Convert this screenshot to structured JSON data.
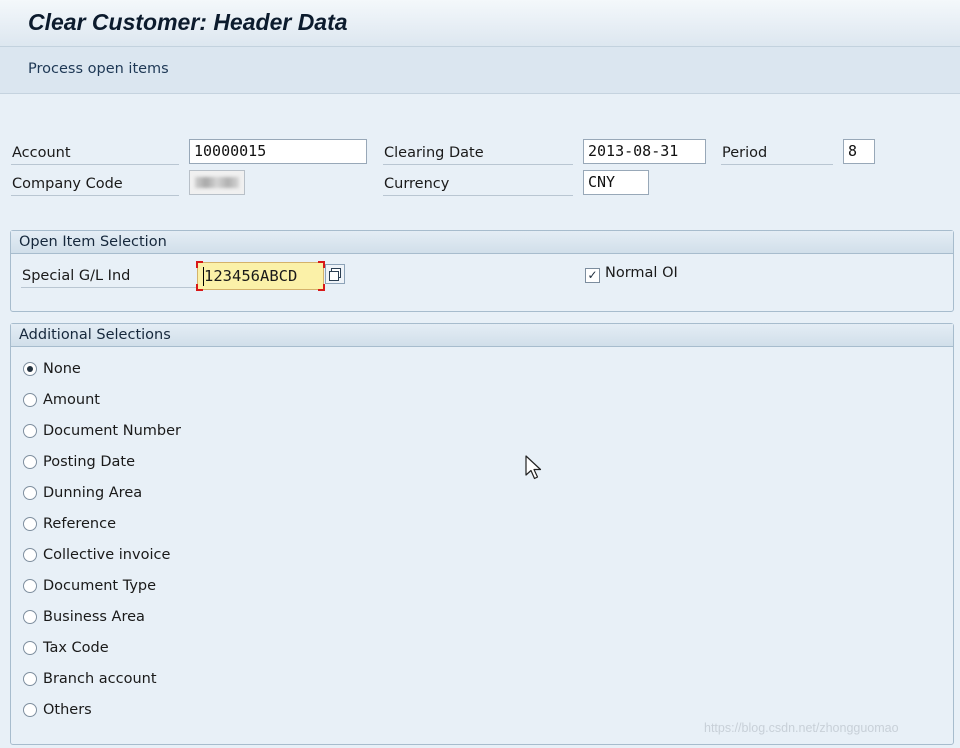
{
  "window": {
    "title": "Clear Customer: Header Data"
  },
  "toolbar": {
    "process_open_items": "Process open items"
  },
  "header": {
    "account": {
      "label": "Account",
      "value": "10000015"
    },
    "clearing_date": {
      "label": "Clearing Date",
      "value": "2013-08-31"
    },
    "period": {
      "label": "Period",
      "value": "8"
    },
    "company_code": {
      "label": "Company Code"
    },
    "currency": {
      "label": "Currency",
      "value": "CNY"
    }
  },
  "open_item_selection": {
    "title": "Open Item Selection",
    "special_gl_ind": {
      "label": "Special G/L Ind",
      "value": "123456ABCD"
    },
    "normal_oi": {
      "label": "Normal OI",
      "checked": true,
      "mark": "✓"
    }
  },
  "additional_selections": {
    "title": "Additional Selections",
    "selected": "None",
    "options": [
      "None",
      "Amount",
      "Document Number",
      "Posting Date",
      "Dunning Area",
      "Reference",
      "Collective invoice",
      "Document Type",
      "Business Area",
      "Tax Code",
      "Branch account",
      "Others"
    ]
  },
  "watermark": "https://blog.csdn.net/zhongguomao",
  "icons": {
    "f4_help": "copy-window-icon",
    "cursor": "mouse-pointer-icon"
  }
}
